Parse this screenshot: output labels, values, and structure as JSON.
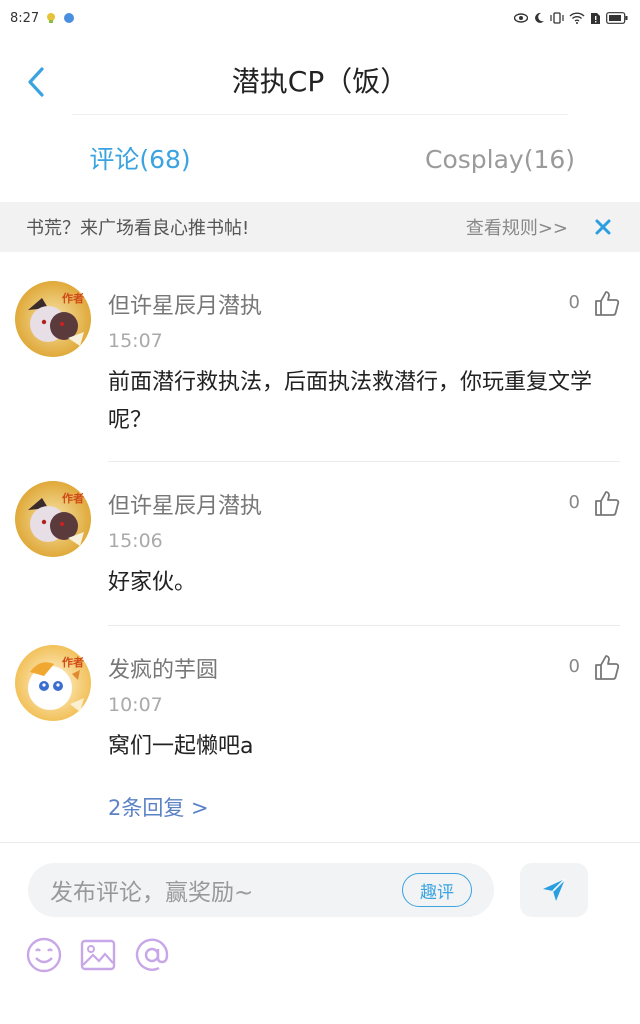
{
  "status_bar": {
    "time": "8:27"
  },
  "header": {
    "title": "潜执CP（饭）"
  },
  "tabs": [
    {
      "label": "评论(68)",
      "active": true
    },
    {
      "label": "Cosplay(16)",
      "active": false
    }
  ],
  "notice": {
    "text": "书荒？来广场看良心推书帖!",
    "rules": "查看规则>>"
  },
  "comments": [
    {
      "username": "但许星辰月潜执",
      "time": "15:07",
      "content": "前面潜行救执法，后面执法救潜行，你玩重复文学呢？",
      "likes": "0",
      "badge": "作者"
    },
    {
      "username": "但许星辰月潜执",
      "time": "15:06",
      "content": "好家伙。",
      "likes": "0",
      "badge": "作者"
    },
    {
      "username": "发疯的芋圆",
      "time": "10:07",
      "content": "窝们一起懒吧a",
      "likes": "0",
      "badge": "作者",
      "replies": "2条回复 >"
    }
  ],
  "composer": {
    "placeholder": "发布评论，赢奖励~",
    "fun_label": "趣评"
  },
  "colors": {
    "accent": "#3aa3e0",
    "reply_link": "#5b82c4",
    "tool_icon": "#c8a7e8"
  }
}
